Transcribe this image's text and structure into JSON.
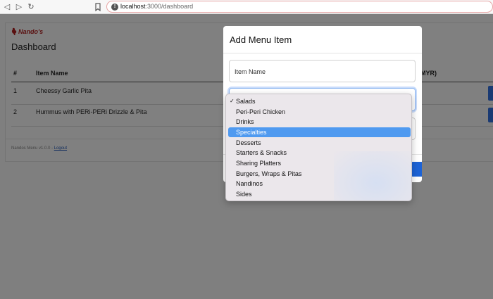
{
  "browser": {
    "url_host": "localhost",
    "url_path": ":3000/dashboard"
  },
  "dashboard": {
    "logo_text": "Nando's",
    "title": "Dashboard",
    "columns": [
      "#",
      "Item Name",
      "MYR)"
    ],
    "rows": [
      {
        "num": "1",
        "name": "Cheessy Garlic Pita"
      },
      {
        "num": "2",
        "name": "Hummus with PERi-PERi Drizzle & Pita"
      }
    ],
    "footer_text": "Nandos Menu v1.0.0 - ",
    "footer_link": "Logout"
  },
  "modal": {
    "title": "Add Menu Item",
    "name_placeholder": "Item Name"
  },
  "dropdown": {
    "checked_mark": "✓",
    "checked_index": 0,
    "highlighted_index": 3,
    "options": [
      "Salads",
      "Peri-Peri Chicken",
      "Drinks",
      "Specialties",
      "Desserts",
      "Starters & Snacks",
      "Sharing Platters",
      "Burgers, Wraps & Pitas",
      "Nandinos",
      "Sides"
    ]
  },
  "colors": {
    "overlay": "#7f7f7f",
    "accent": "#1d63d6",
    "highlight": "#4f9af0",
    "brand": "#8a1414"
  }
}
